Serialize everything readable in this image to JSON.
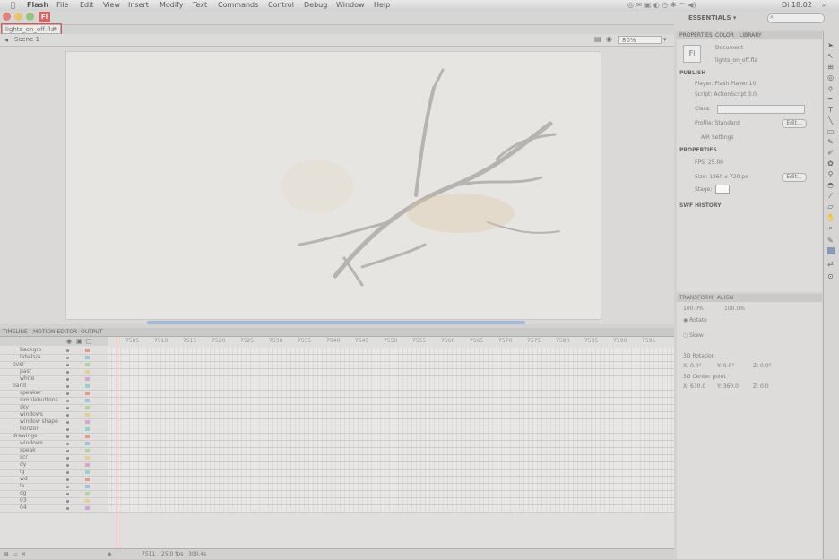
{
  "menubar": {
    "apple": "",
    "items": [
      "Flash",
      "File",
      "Edit",
      "View",
      "Insert",
      "Modify",
      "Text",
      "Commands",
      "Control",
      "Debug",
      "Window",
      "Help"
    ],
    "clock": "Di 18:02"
  },
  "window": {
    "app_badge": "Fl",
    "doc_tab": "lights_on_off.fla*",
    "scene": "Scene 1",
    "zoom": "80%"
  },
  "workspace": {
    "label": "ESSENTIALS ▾"
  },
  "timeline": {
    "tabs": [
      "TIMELINE",
      "MOTION EDITOR",
      "OUTPUT"
    ],
    "frame_labels": [
      "7505",
      "7510",
      "7515",
      "7520",
      "7525",
      "7530",
      "7535",
      "7540",
      "7545",
      "7550",
      "7555",
      "7560",
      "7565",
      "7570",
      "7575",
      "7580",
      "7585",
      "7590",
      "7595"
    ],
    "layers": [
      "Backgro",
      "labels/a",
      "over",
      "past",
      "white",
      "band",
      "speaker",
      "simplebuttons",
      "sky",
      "windows",
      "window shape",
      "horizon",
      "drawings",
      "windows",
      "speak",
      "scr",
      "dy",
      "lg",
      "wd",
      "la",
      "dg",
      "03",
      "04"
    ],
    "status": [
      "7511",
      "25.0 fps",
      "300.4s"
    ]
  },
  "panel_tabs": [
    "PROPERTIES",
    "COLOR",
    "LIBRARY"
  ],
  "properties": {
    "doc_label": "Document",
    "doc_name": "lights_on_off.fla",
    "publish_header": "PUBLISH",
    "player": "Player: Flash Player 10",
    "script": "Script: ActionScript 3.0",
    "class_label": "Class:",
    "profile": "Profile: Standard",
    "edit_btn": "Edit...",
    "air": "AIR Settings",
    "properties_header": "PROPERTIES",
    "fps": "FPS: 25.00",
    "size": "Size: 1260 x 720 px",
    "edit_btn2": "Edit...",
    "stage_label": "Stage:",
    "swf_header": "SWF HISTORY"
  },
  "transform": {
    "tabs": [
      "TRANSFORM",
      "ALIGN"
    ],
    "scale_w": "100.0%",
    "scale_h": "100.0%",
    "rotate": "Rotate",
    "skew": "Skew",
    "rot3d": "3D Rotation",
    "x": "X: 0.0°",
    "y": "Y: 0.0°",
    "z": "Z: 0.0°",
    "center": "3D Center point",
    "cx": "X: 630.0",
    "cy": "Y: 360.0",
    "cz": "Z: 0.0"
  },
  "colors": {
    "stage_bg": "#e6e4df",
    "playhead": "#dd3333",
    "scrollbar": "#8aa7cf",
    "doc_tab_outline": "#cc2222"
  }
}
